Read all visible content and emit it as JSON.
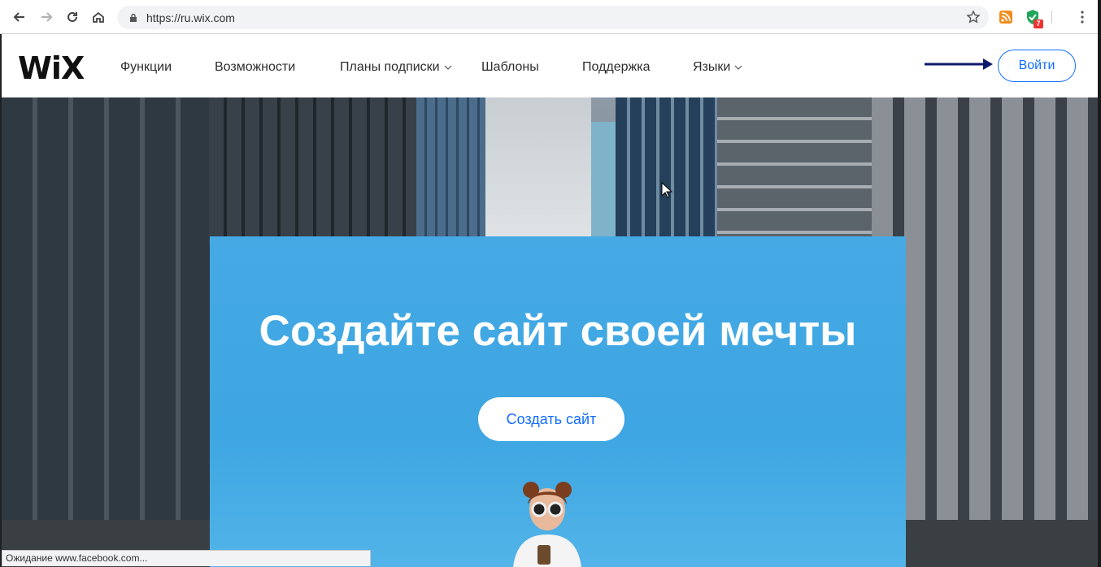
{
  "browser": {
    "url": "https://ru.wix.com",
    "extension_badge": "7",
    "status_text": "Ожидание www.facebook.com..."
  },
  "site": {
    "logo": "WiX",
    "nav": [
      {
        "label": "Функции",
        "has_dropdown": false
      },
      {
        "label": "Возможности",
        "has_dropdown": false
      },
      {
        "label": "Планы подписки",
        "has_dropdown": true
      },
      {
        "label": "Шаблоны",
        "has_dropdown": false
      },
      {
        "label": "Поддержка",
        "has_dropdown": false
      },
      {
        "label": "Языки",
        "has_dropdown": true
      }
    ],
    "login_label": "Войти"
  },
  "hero": {
    "title": "Создайте сайт своей мечты",
    "cta_label": "Создать сайт"
  },
  "colors": {
    "brand_blue": "#116dff",
    "hero_blue": "#3ea6e2",
    "annotation_arrow": "#0d1a6b"
  }
}
